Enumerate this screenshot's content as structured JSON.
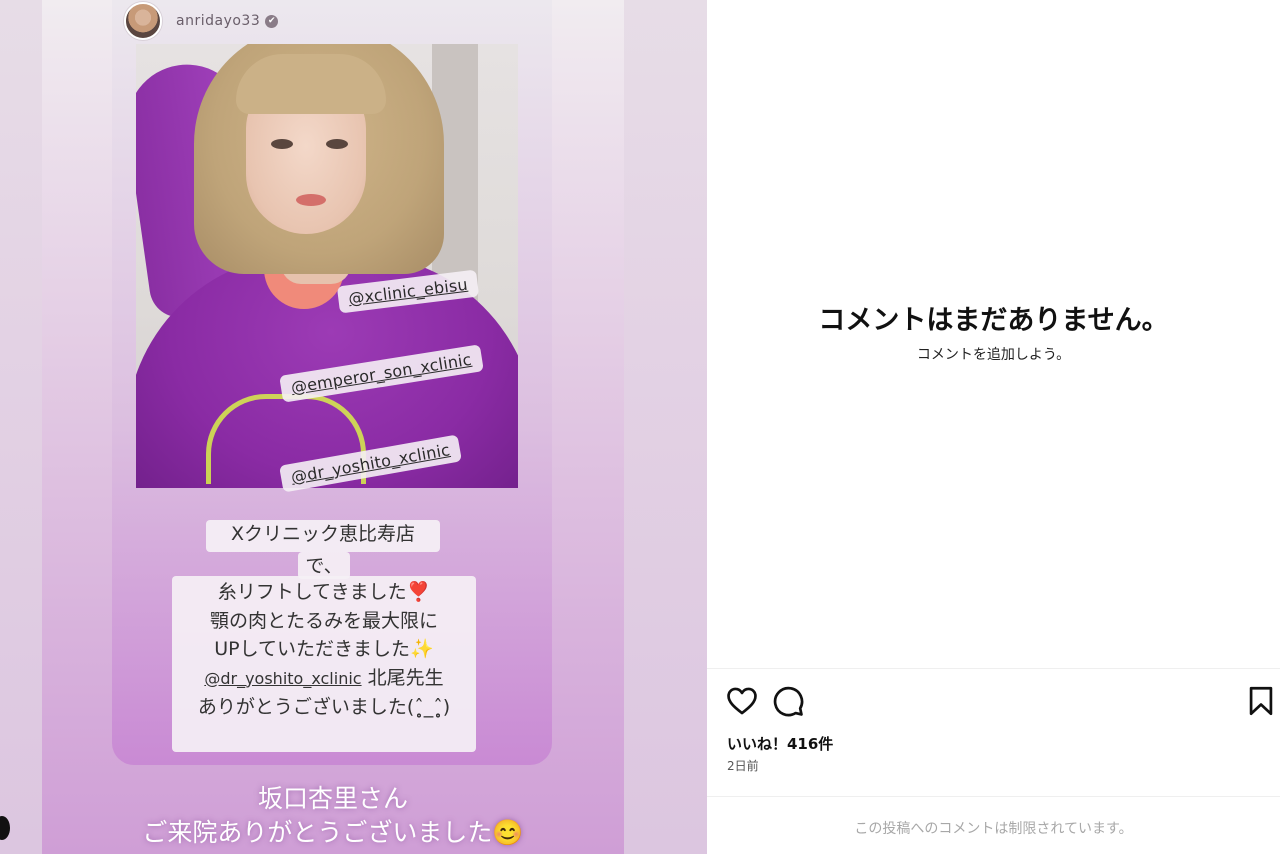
{
  "story": {
    "username": "anridayo33",
    "verified_glyph": "✔",
    "tags": [
      "@xclinic_ebisu",
      "@emperor_son_xclinic",
      "@dr_yoshito_xclinic"
    ],
    "caption_lines": [
      "Xクリニック恵比寿店",
      "で、",
      "糸リフトしてきました❣️",
      "顎の肉とたるみを最大限に",
      "UPしていただきました✨",
      "@dr_yoshito_xclinic",
      "北尾先生",
      "ありがとうございました(ˆ̥̥̥̥_ˆ̥̥̥̥)"
    ],
    "bottom_line1": "坂口杏里さん",
    "bottom_line2": "ご来院ありがとうございました😊"
  },
  "comments": {
    "empty_title": "コメントはまだありません。",
    "empty_subtitle": "コメントを追加しよう。"
  },
  "actions": {
    "like_icon": "heart-icon",
    "comment_icon": "comment-icon",
    "save_icon": "bookmark-icon"
  },
  "stats": {
    "likes": "いいね！416件",
    "time": "2日前"
  },
  "footer": {
    "restricted": "この投稿へのコメントは制限されています。"
  }
}
